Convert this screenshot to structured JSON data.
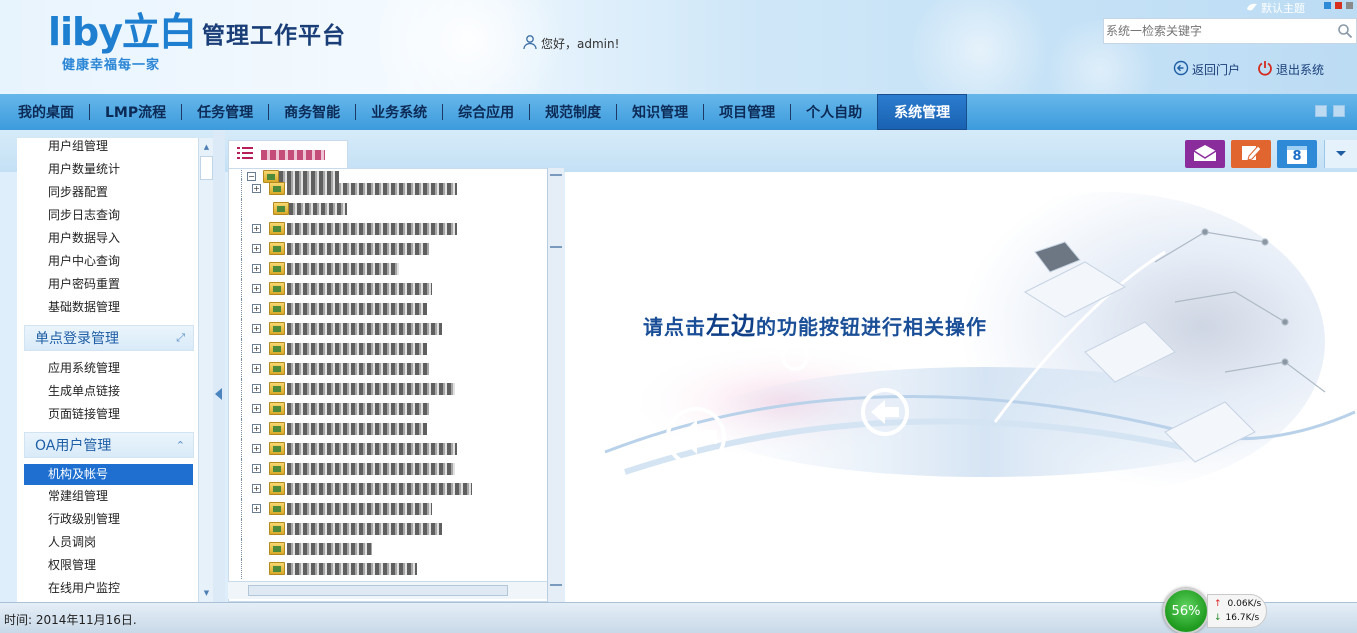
{
  "header": {
    "logo_text": "liby立白",
    "logo_slogan": "健康幸福每一家",
    "platform_title": "管理工作平台",
    "greeting": "您好，admin!",
    "theme_label": "默认主题",
    "search_placeholder": "系统一检索关键字",
    "return_portal": "返回门户",
    "logout": "退出系统"
  },
  "nav": {
    "items": [
      {
        "label": "我的桌面"
      },
      {
        "label": "LMP流程"
      },
      {
        "label": "任务管理"
      },
      {
        "label": "商务智能"
      },
      {
        "label": "业务系统"
      },
      {
        "label": "综合应用"
      },
      {
        "label": "规范制度"
      },
      {
        "label": "知识管理"
      },
      {
        "label": "项目管理"
      },
      {
        "label": "个人自助"
      },
      {
        "label": "系统管理"
      }
    ],
    "active": "系统管理"
  },
  "toolbar": {
    "calendar_day": "8",
    "icons": [
      "mail-icon",
      "edit-icon",
      "calendar-icon",
      "dropdown-icon"
    ]
  },
  "sidebar": {
    "top_items": [
      "用户组管理",
      "用户数量统计",
      "同步器配置",
      "同步日志查询",
      "用户数据导入",
      "用户中心查询",
      "用户密码重置",
      "基础数据管理"
    ],
    "sso_group": "单点登录管理",
    "sso_items": [
      "应用系统管理",
      "生成单点链接",
      "页面链接管理"
    ],
    "oa_group": "OA用户管理",
    "oa_items": [
      "机构及帐号",
      "常建组管理",
      "行政级别管理",
      "人员调岗",
      "权限管理",
      "在线用户监控"
    ],
    "selected": "机构及帐号"
  },
  "main": {
    "welcome_pre": "请点击",
    "welcome_big": "左边",
    "welcome_post": "的功能按钮进行相关操作"
  },
  "status": {
    "time": "时间: 2014年11月16日.",
    "cpu_percent": "56%",
    "upload": "0.06K/s",
    "download": "16.7K/s"
  },
  "colors": {
    "nav_bg": "#4aa6e2",
    "nav_active": "#1e6fc8",
    "sidebar_selected": "#1e6fd0",
    "brand_blue": "#1e7fd0"
  }
}
